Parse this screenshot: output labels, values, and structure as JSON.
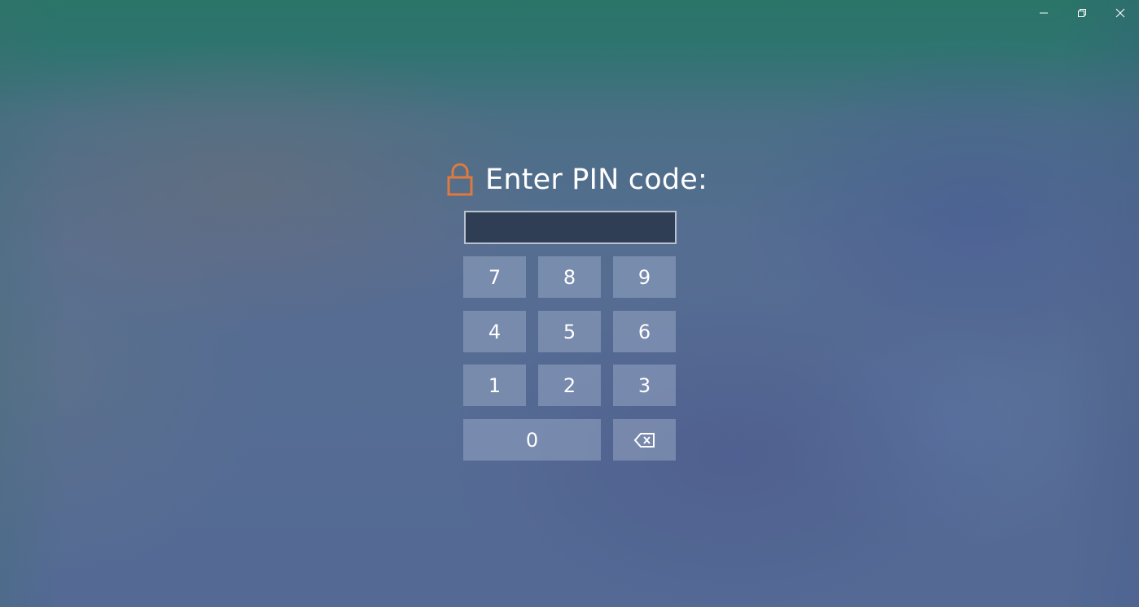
{
  "window_controls": {
    "minimize_icon": "minimize-icon",
    "restore_icon": "restore-icon",
    "close_icon": "close-icon"
  },
  "pin_prompt": {
    "title": "Enter PIN code:",
    "lock_icon": "lock-icon",
    "lock_color": "#e07a3c",
    "input_value": "",
    "input_placeholder": ""
  },
  "keypad": {
    "keys": [
      {
        "label": "7"
      },
      {
        "label": "8"
      },
      {
        "label": "9"
      },
      {
        "label": "4"
      },
      {
        "label": "5"
      },
      {
        "label": "6"
      },
      {
        "label": "1"
      },
      {
        "label": "2"
      },
      {
        "label": "3"
      },
      {
        "label": "0"
      }
    ],
    "backspace_icon": "backspace-icon"
  }
}
